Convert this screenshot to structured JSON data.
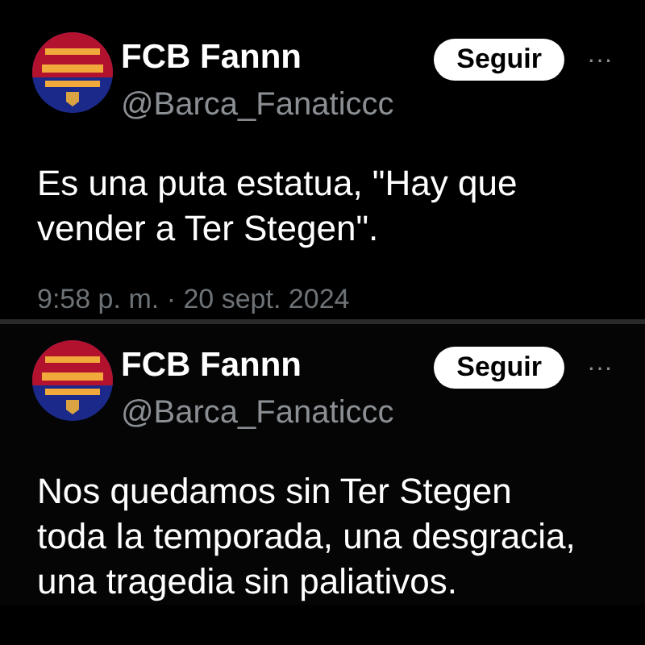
{
  "tweets": [
    {
      "author": {
        "name": "FCB Fannn",
        "handle": "@Barca_Fanaticcc"
      },
      "follow_button": "Seguir",
      "more": "···",
      "text": "Es una puta estatua, \"Hay que vender a Ter Stegen\".",
      "timestamp": "9:58 p. m. · 20 sept. 2024"
    },
    {
      "author": {
        "name": "FCB Fannn",
        "handle": "@Barca_Fanaticcc"
      },
      "follow_button": "Seguir",
      "more": "···",
      "text": "Nos quedamos sin Ter Stegen toda la temporada, una desgracia, una tragedia sin paliativos."
    }
  ]
}
